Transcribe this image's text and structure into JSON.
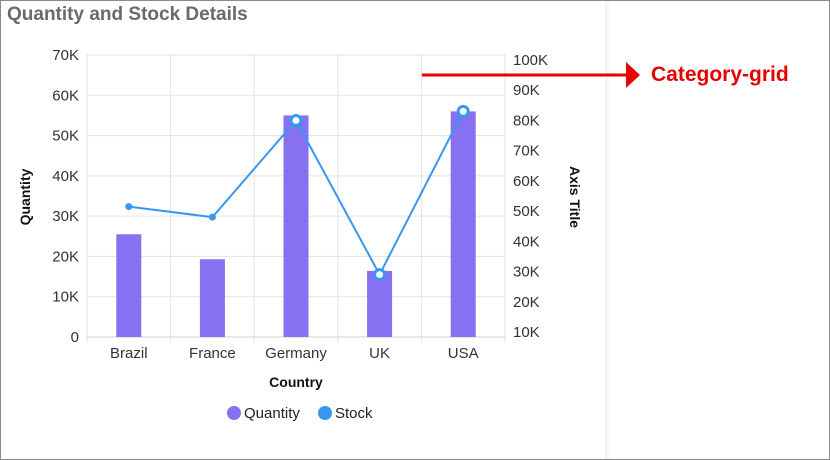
{
  "card": {
    "title": "Quantity and Stock Details"
  },
  "annotation": {
    "label": "Category-grid",
    "color": "#e60000"
  },
  "chart_data": {
    "type": "bar+line",
    "categories": [
      "Brazil",
      "France",
      "Germany",
      "UK",
      "USA"
    ],
    "xlabel": "Country",
    "y_left": {
      "label": "Quantity",
      "ticks": [
        0,
        10000,
        20000,
        30000,
        40000,
        50000,
        60000,
        70000
      ],
      "tick_labels": [
        "0",
        "10K",
        "20K",
        "30K",
        "40K",
        "50K",
        "60K",
        "70K"
      ],
      "range": [
        0,
        70000
      ]
    },
    "y_right": {
      "label": "Axis Title",
      "ticks": [
        10000,
        20000,
        30000,
        40000,
        50000,
        60000,
        70000,
        80000,
        90000,
        100000
      ],
      "tick_labels": [
        "10K",
        "20K",
        "30K",
        "40K",
        "50K",
        "60K",
        "70K",
        "80K",
        "90K",
        "100K"
      ],
      "range": [
        10000,
        100000
      ]
    },
    "series": [
      {
        "name": "Quantity",
        "type": "bar",
        "axis": "left",
        "color": "#8770f2",
        "values": [
          25500,
          19300,
          55000,
          16400,
          56000
        ]
      },
      {
        "name": "Stock",
        "type": "line",
        "axis": "right",
        "color": "#3797f0",
        "values": [
          51500,
          48000,
          80000,
          29000,
          83000
        ]
      }
    ],
    "legend_position": "bottom",
    "grid": true,
    "highlighted_points": [
      "Germany",
      "UK",
      "USA"
    ]
  }
}
